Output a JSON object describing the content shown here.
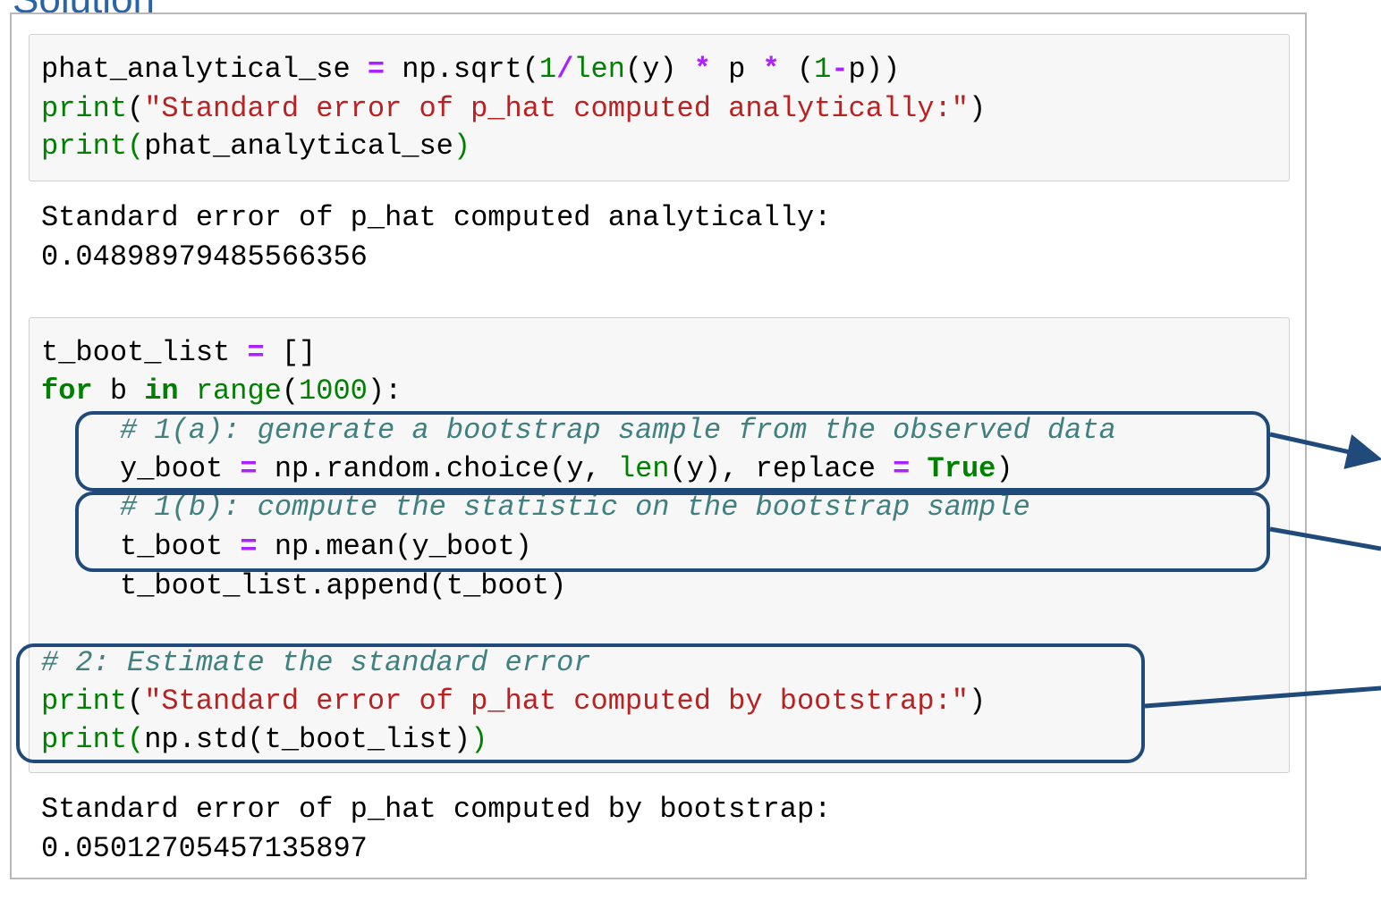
{
  "heading": "Solution",
  "cell1": {
    "line1": {
      "a": "phat_analytical_se ",
      "b": "=",
      "c": " np.sqrt(",
      "d": "1",
      "e": "/",
      "f": "len",
      "g": "(y) ",
      "h": "*",
      "i": " p ",
      "j": "*",
      "k": " (",
      "l": "1",
      "m": "-",
      "n": "p))"
    },
    "line2": {
      "a": "print",
      "b": "(",
      "c": "\"Standard error of p_hat computed analytically:\"",
      "d": ")"
    },
    "line3": {
      "a": "print",
      "b": "(",
      "c": "phat_analytical_se",
      "d": ")"
    }
  },
  "output1": {
    "line1": "Standard error of p_hat computed analytically:",
    "line2": "0.04898979485566356"
  },
  "cell2": {
    "l1": {
      "a": "t_boot_list ",
      "b": "=",
      "c": " []"
    },
    "l2": {
      "a": "for",
      "b": " b ",
      "c": "in",
      "d": " ",
      "e": "range",
      "f": "(",
      "g": "1000",
      "h": "):"
    },
    "l3": "# 1(a): generate a bootstrap sample from the observed data",
    "l4": {
      "a": "y_boot ",
      "b": "=",
      "c": " np.random.choice(y, ",
      "d": "len",
      "e": "(y), replace ",
      "f": "=",
      "g": " ",
      "h": "True",
      "i": ")"
    },
    "l5": "# 1(b): compute the statistic on the bootstrap sample",
    "l6": {
      "a": "t_boot ",
      "b": "=",
      "c": " np.mean(y_boot)"
    },
    "l7": "t_boot_list.append(t_boot)",
    "l8": "# 2: Estimate the standard error",
    "l9": {
      "a": "print",
      "b": "(",
      "c": "\"Standard error of p_hat computed by bootstrap:\"",
      "d": ")"
    },
    "l10": {
      "a": "print",
      "b": "(",
      "c": "np.std(t_boot_list)",
      "d": ")"
    }
  },
  "output2": {
    "line1": "Standard error of p_hat computed by bootstrap:",
    "line2": "0.05012705457135897"
  },
  "colors": {
    "annotation_box": "#1f4a7a",
    "heading": "#2a64a8"
  }
}
